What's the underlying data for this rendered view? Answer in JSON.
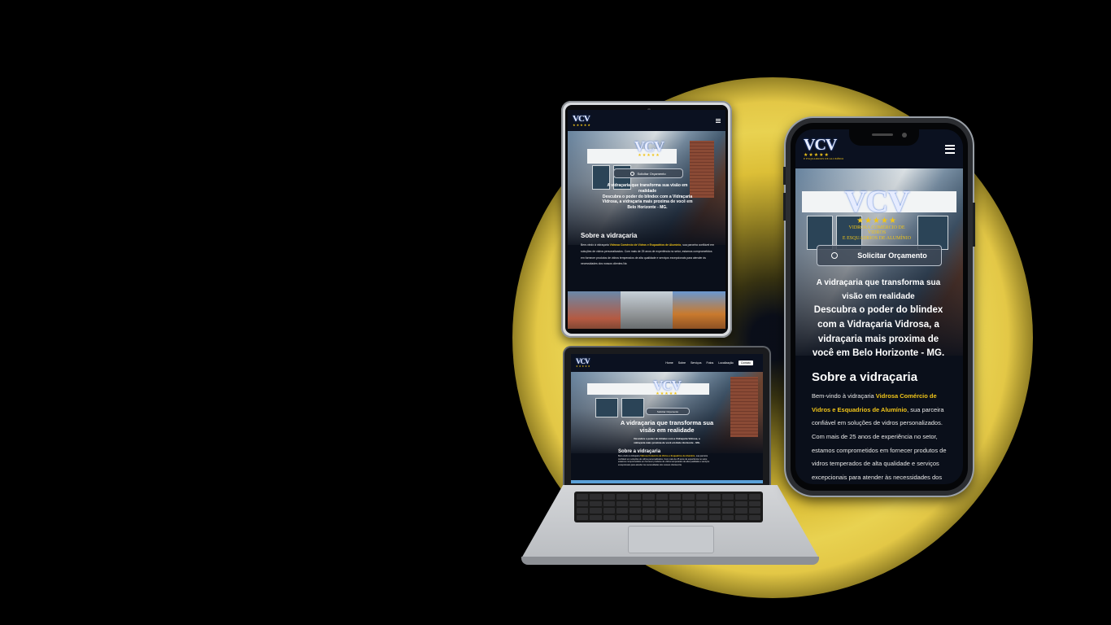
{
  "brand": {
    "logo_mark": "VCV",
    "stars": "★★★★★",
    "logo_sub_1": "Vidrosa Comércio de",
    "logo_sub_2": "Vidros",
    "logo_sub_3": "e Esquadrios de Alumínio"
  },
  "hero": {
    "cta_label": "Solicitar Orçamento",
    "headline_1": "A vidraçaria que transforma sua visão em realidade",
    "headline_2": "Descubra o poder do blindex com a Vidraçaria Vidrosa, a vidraçaria mais proxima de você em Belo Horizonte - MG."
  },
  "about": {
    "title": "Sobre a vidraçaria",
    "lead": "Bem-vindo à vidraçaria ",
    "highlight": "Vidrosa Comércio de Vidros e Esquadrios de Alumínio",
    "body": ", sua parceira confiável em soluções de vidros personalizados. Com mais de 25 anos de experiência no setor, estamos comprometidos em fornecer produtos de vidros temperados de alta qualidade e serviços excepcionais para atender às necessidades dos nossos clientes.Na"
  },
  "laptop_menu": [
    "Home",
    "Sobre",
    "Serviços",
    "Fotos",
    "Localização",
    "Contato"
  ],
  "colors": {
    "accent": "#f0c419",
    "navy": "#0b1120",
    "glow": "#f5dd55"
  }
}
